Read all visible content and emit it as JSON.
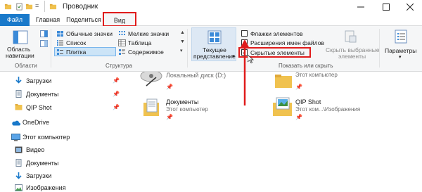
{
  "window": {
    "title": "Проводник",
    "minimize_icon": "minimize-icon",
    "maximize_icon": "maximize-icon",
    "close_icon": "close-icon"
  },
  "tabs": {
    "file": "Файл",
    "home": "Главная",
    "share": "Поделиться",
    "view": "Вид"
  },
  "ribbon": {
    "panes": {
      "nav_pane_line1": "Область",
      "nav_pane_line2": "навигации",
      "group": "Области"
    },
    "layout": {
      "normal_icons": "Обычные значки",
      "small_icons": "Мелкие значки",
      "list": "Список",
      "table": "Таблица",
      "tiles": "Плитка",
      "content": "Содержимое",
      "group": "Структура"
    },
    "current_view": {
      "line1": "Текущее",
      "line2": "представление"
    },
    "show_hide": {
      "item_checkboxes": "Флажки элементов",
      "file_extensions": "Расширения имен файлов",
      "hidden_items": "Скрытые элементы",
      "hide_selected_line1": "Скрыть выбранные",
      "hide_selected_line2": "элементы",
      "group": "Показать или скрыть",
      "item_checkboxes_checked": false,
      "file_extensions_checked": true,
      "hidden_items_checked": true
    },
    "options": {
      "label": "Параметры"
    }
  },
  "sidebar": {
    "quick_access": [
      {
        "label": "Загрузки",
        "icon": "download-arrow-icon"
      },
      {
        "label": "Документы",
        "icon": "documents-icon"
      },
      {
        "label": "QIP Shot",
        "icon": "folder-icon"
      }
    ],
    "onedrive": "OneDrive",
    "this_pc": "Этот компьютер",
    "pc_items": [
      {
        "label": "Видео",
        "icon": "video-icon"
      },
      {
        "label": "Документы",
        "icon": "documents-icon"
      },
      {
        "label": "Загрузки",
        "icon": "download-arrow-icon"
      },
      {
        "label": "Изображения",
        "icon": "pictures-icon"
      }
    ]
  },
  "main": {
    "items": [
      {
        "title": "Локальный диск (D:)",
        "sub": ""
      },
      {
        "title": "",
        "sub": "Этот компьютер"
      },
      {
        "title": "Документы",
        "sub": "Этот компьютер"
      },
      {
        "title": "QIP Shot",
        "sub": "Этот ком...\\Изображения"
      }
    ]
  },
  "colors": {
    "accent": "#1979ca",
    "highlight": "#e01b1b",
    "folder": "#f0c24f"
  }
}
